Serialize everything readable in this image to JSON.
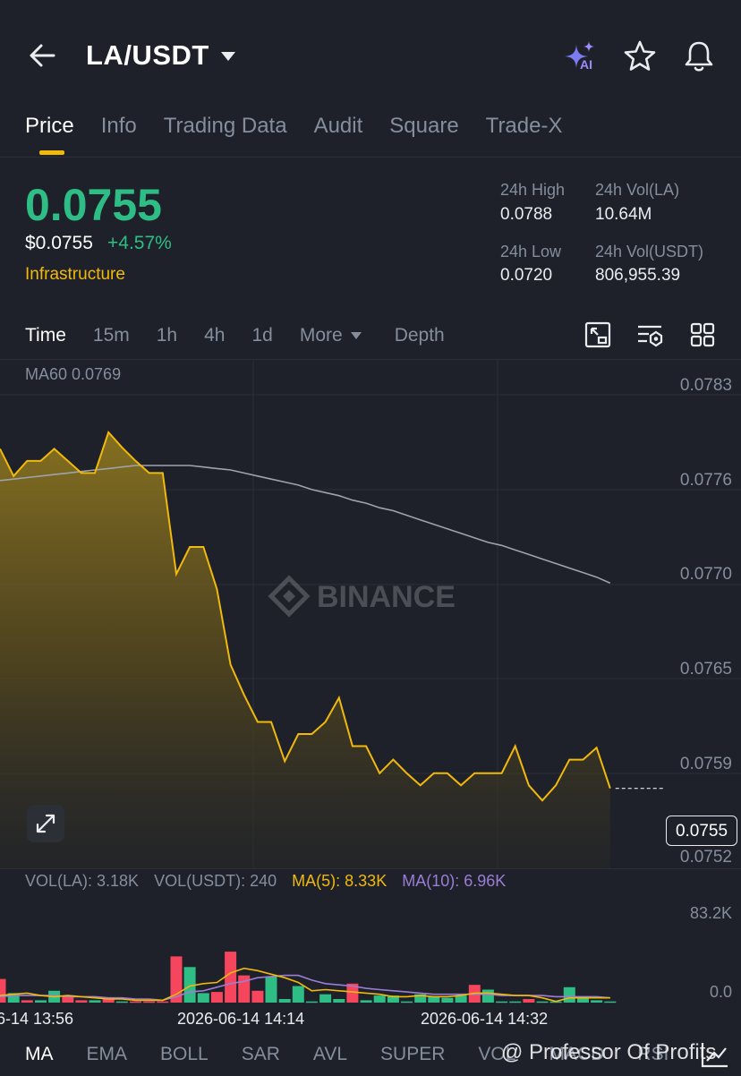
{
  "header": {
    "pair": "LA/USDT",
    "ai_badge": "AI",
    "icons": [
      "back-arrow-icon",
      "caret-down-icon",
      "ai-sparkle-icon",
      "star-icon",
      "bell-icon"
    ]
  },
  "tabs": [
    {
      "label": "Price",
      "active": true
    },
    {
      "label": "Info",
      "active": false
    },
    {
      "label": "Trading Data",
      "active": false
    },
    {
      "label": "Audit",
      "active": false
    },
    {
      "label": "Square",
      "active": false
    },
    {
      "label": "Trade-X",
      "active": false
    }
  ],
  "ticker": {
    "last_price": "0.0755",
    "usd_price": "$0.0755",
    "change": "+4.57%",
    "category": "Infrastructure",
    "high_label": "24h High",
    "high_value": "0.0788",
    "low_label": "24h Low",
    "low_value": "0.0720",
    "vol_base_label": "24h Vol(LA)",
    "vol_base_value": "10.64M",
    "vol_quote_label": "24h Vol(USDT)",
    "vol_quote_value": "806,955.39"
  },
  "intervals": {
    "items": [
      "Time",
      "15m",
      "1h",
      "4h",
      "1d"
    ],
    "active": "Time",
    "more": "More",
    "depth": "Depth"
  },
  "colors": {
    "up": "#2ebd85",
    "down": "#f6465d",
    "accent": "#f0b90b",
    "ma10": "#9c7dd6",
    "ma60": "#9ea3ab",
    "background": "#1e2129"
  },
  "chart": {
    "ma60_label": "MA60 0.0769",
    "watermark": "BINANCE",
    "current_price_tag": "0.0755",
    "price_ticks": [
      "0.0783",
      "0.0776",
      "0.0770",
      "0.0765",
      "0.0759",
      "0.0752"
    ],
    "vol_legend": {
      "vol_base": "VOL(LA): 3.18K",
      "vol_quote": "VOL(USDT): 240",
      "ma5": "MA(5): 8.33K",
      "ma10": "MA(10): 6.96K"
    },
    "vol_ticks": [
      "83.2K",
      "0.0"
    ],
    "time_labels": [
      "6-14 13:56",
      "2026-06-14 14:14",
      "2026-06-14 14:32"
    ]
  },
  "chart_data": {
    "type": "area",
    "ylim": [
      0.07515,
      0.07852
    ],
    "price": [
      0.07793,
      0.07775,
      0.07785,
      0.07785,
      0.07793,
      0.07785,
      0.07777,
      0.07777,
      0.07804,
      0.07794,
      0.07785,
      0.07777,
      0.07777,
      0.0771,
      0.07728,
      0.07728,
      0.077,
      0.0765,
      0.0763,
      0.07612,
      0.07612,
      0.07586,
      0.07604,
      0.07604,
      0.07612,
      0.07628,
      0.07596,
      0.07596,
      0.07578,
      0.07587,
      0.07578,
      0.0757,
      0.07578,
      0.07578,
      0.0757,
      0.07578,
      0.07578,
      0.07578,
      0.07596,
      0.0757,
      0.0756,
      0.0757,
      0.07587,
      0.07587,
      0.07595,
      0.07568
    ],
    "ma60": [
      0.07772,
      0.07773,
      0.07774,
      0.07775,
      0.07776,
      0.07777,
      0.07778,
      0.07779,
      0.0778,
      0.07781,
      0.07782,
      0.07782,
      0.07782,
      0.07782,
      0.07782,
      0.07781,
      0.0778,
      0.07779,
      0.07777,
      0.07775,
      0.07773,
      0.07771,
      0.07769,
      0.07766,
      0.07764,
      0.07762,
      0.07759,
      0.07757,
      0.07754,
      0.07752,
      0.07749,
      0.07746,
      0.07743,
      0.0774,
      0.07737,
      0.07734,
      0.07731,
      0.07729,
      0.07726,
      0.07723,
      0.0772,
      0.07717,
      0.07714,
      0.07711,
      0.07708,
      0.07704
    ],
    "volume_ylim": [
      0,
      83.2
    ],
    "volume_bars": [
      {
        "v": 20,
        "up": false
      },
      {
        "v": 8,
        "up": true
      },
      {
        "v": 2,
        "up": false
      },
      {
        "v": 2,
        "up": true
      },
      {
        "v": 10,
        "up": true
      },
      {
        "v": 5,
        "up": false
      },
      {
        "v": 2,
        "up": false
      },
      {
        "v": 2,
        "up": true
      },
      {
        "v": 3,
        "up": false
      },
      {
        "v": 1,
        "up": true
      },
      {
        "v": 1,
        "up": false
      },
      {
        "v": 1,
        "up": false
      },
      {
        "v": 1,
        "up": false
      },
      {
        "v": 39,
        "up": false
      },
      {
        "v": 30,
        "up": true
      },
      {
        "v": 8,
        "up": true
      },
      {
        "v": 9,
        "up": false
      },
      {
        "v": 43,
        "up": false
      },
      {
        "v": 23,
        "up": false
      },
      {
        "v": 10,
        "up": false
      },
      {
        "v": 22,
        "up": true
      },
      {
        "v": 3,
        "up": true
      },
      {
        "v": 14,
        "up": true
      },
      {
        "v": 1,
        "up": true
      },
      {
        "v": 7,
        "up": true
      },
      {
        "v": 3,
        "up": true
      },
      {
        "v": 16,
        "up": false
      },
      {
        "v": 2,
        "up": true
      },
      {
        "v": 6,
        "up": true
      },
      {
        "v": 6,
        "up": true
      },
      {
        "v": 1,
        "up": true
      },
      {
        "v": 7,
        "up": true
      },
      {
        "v": 5,
        "up": true
      },
      {
        "v": 4,
        "up": true
      },
      {
        "v": 6,
        "up": true
      },
      {
        "v": 15,
        "up": false
      },
      {
        "v": 11,
        "up": true
      },
      {
        "v": 1,
        "up": true
      },
      {
        "v": 1,
        "up": true
      },
      {
        "v": 3,
        "up": false
      },
      {
        "v": 1,
        "up": true
      },
      {
        "v": 1,
        "up": true
      },
      {
        "v": 13,
        "up": true
      },
      {
        "v": 4,
        "up": true
      },
      {
        "v": 2,
        "up": true
      },
      {
        "v": 1,
        "up": true
      }
    ],
    "vol_ma5": [
      6,
      7,
      8,
      6,
      5,
      6,
      5,
      4,
      3,
      3,
      2,
      2,
      2,
      7,
      14,
      16,
      17,
      25,
      29,
      27,
      24,
      21,
      17,
      10,
      11,
      10,
      9,
      8,
      7,
      5,
      5,
      6,
      5,
      5,
      6,
      8,
      8,
      7,
      6,
      6,
      4,
      1,
      4,
      4,
      4,
      4
    ],
    "vol_ma10": [
      5,
      6,
      6,
      6,
      6,
      5,
      5,
      5,
      4,
      4,
      3,
      3,
      2,
      5,
      9,
      10,
      13,
      16,
      18,
      21,
      22,
      23,
      23,
      19,
      16,
      15,
      14,
      12,
      11,
      10,
      9,
      8,
      7,
      7,
      7,
      7,
      7,
      6,
      6,
      6,
      6,
      5,
      5,
      5,
      5,
      4
    ]
  },
  "indicators": {
    "items": [
      "MA",
      "EMA",
      "BOLL",
      "SAR",
      "AVL",
      "SUPER",
      "VOL",
      "MACD",
      "RSI"
    ],
    "active": "MA"
  },
  "watermark_post": "@ Professor Of Profits"
}
